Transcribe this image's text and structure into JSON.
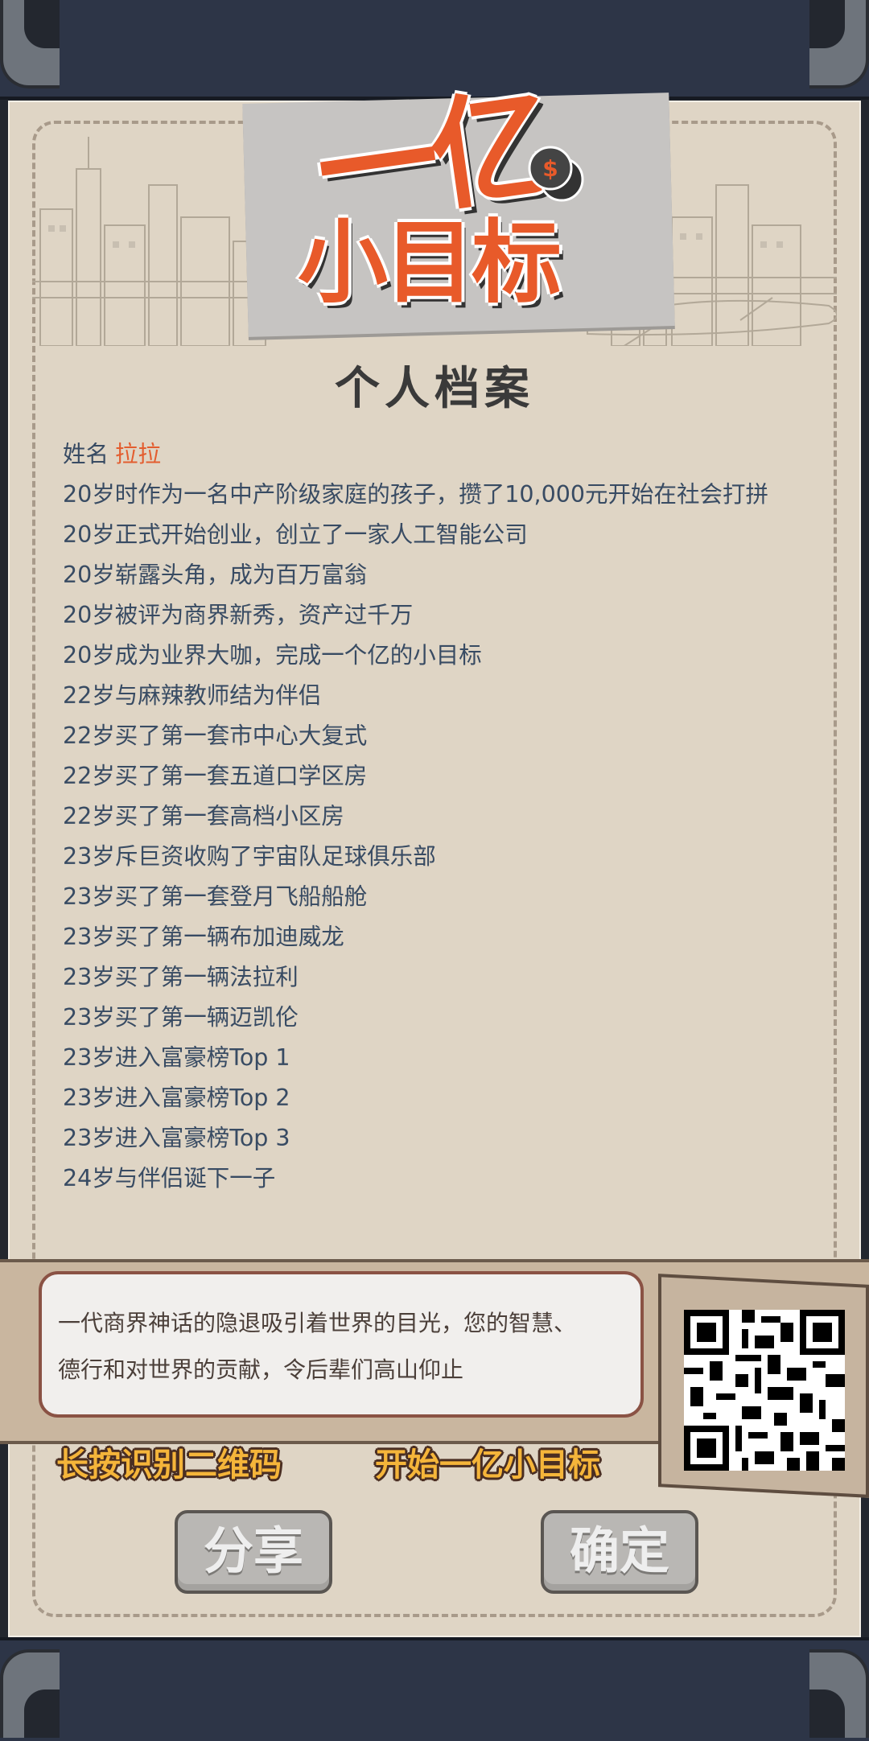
{
  "logo": {
    "line1": "一亿",
    "line2": "小目标"
  },
  "heading": "个人档案",
  "profile": {
    "name_label": "姓名",
    "name_value": "拉拉",
    "story": [
      "20岁时作为一名中产阶级家庭的孩子，攒了10,000元开始在社会打拼",
      "20岁正式开始创业，创立了一家人工智能公司",
      "20岁崭露头角，成为百万富翁",
      "20岁被评为商界新秀，资产过千万",
      "20岁成为业界大咖，完成一个亿的小目标",
      "22岁与麻辣教师结为伴侣",
      "22岁买了第一套市中心大复式",
      "22岁买了第一套五道口学区房",
      "22岁买了第一套高档小区房",
      "23岁斥巨资收购了宇宙队足球俱乐部",
      "23岁买了第一套登月飞船船舱",
      "23岁买了第一辆布加迪威龙",
      "23岁买了第一辆法拉利",
      "23岁买了第一辆迈凯伦",
      "23岁进入富豪榜Top 1",
      "23岁进入富豪榜Top 2",
      "23岁进入富豪榜Top 3",
      "24岁与伴侣诞下一子"
    ]
  },
  "summary": {
    "line1": "一代商界神话的隐退吸引着世界的目光，您的智慧、",
    "line2": "德行和对世界的贡献，令后辈们高山仰止"
  },
  "captions": {
    "left": "长按识别二维码",
    "right": "开始一亿小目标"
  },
  "buttons": {
    "share": "分享",
    "confirm": "确定"
  },
  "colors": {
    "accent": "#e35d2f",
    "text": "#384b63",
    "paper": "#dfd5c5",
    "caption": "#f5b53a"
  }
}
